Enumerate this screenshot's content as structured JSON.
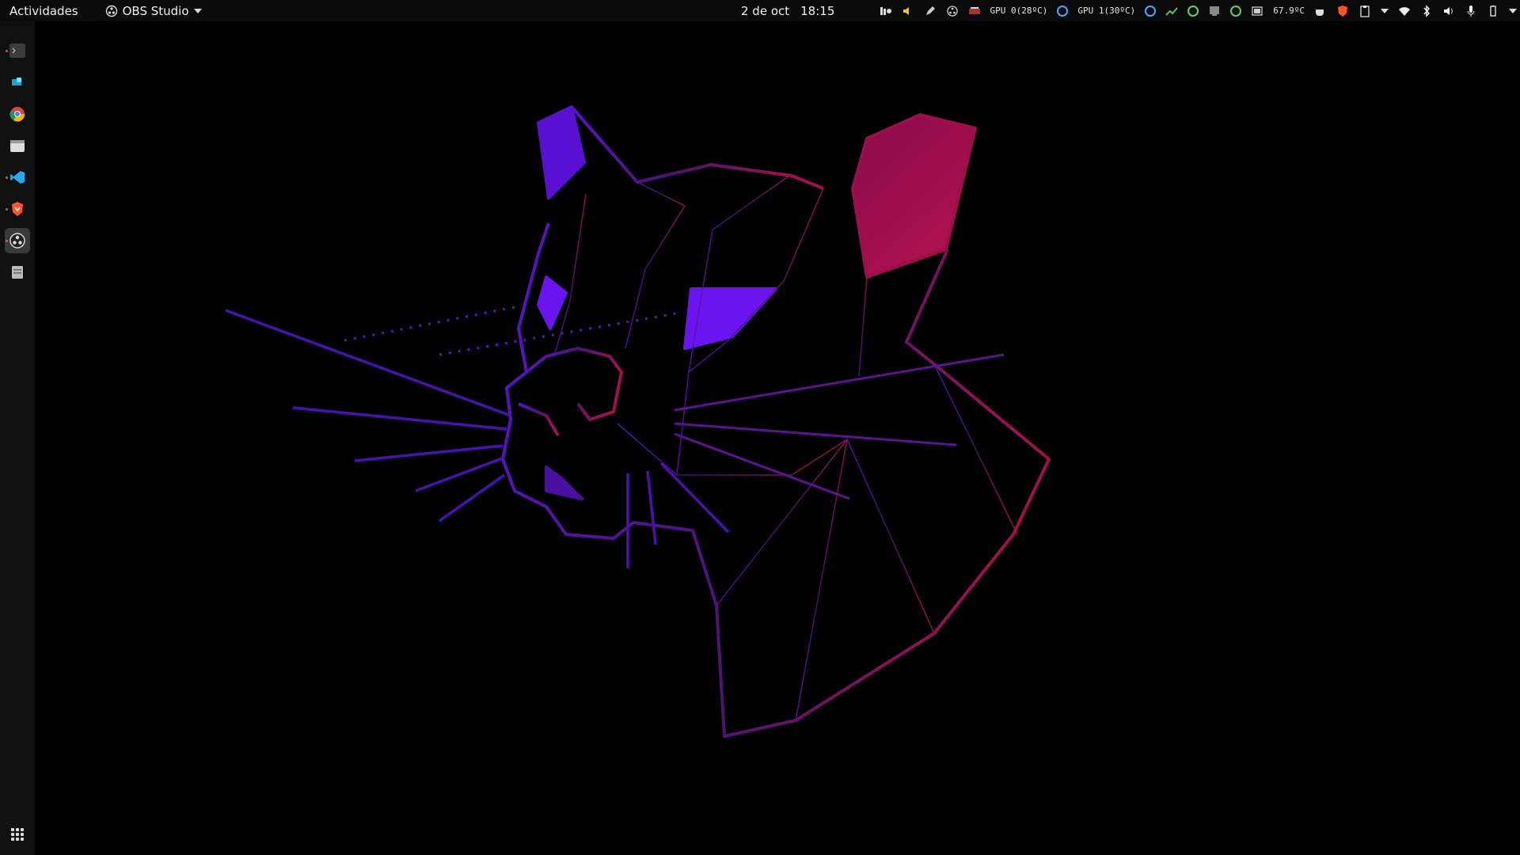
{
  "topbar": {
    "activities": "Actividades",
    "app_menu": "OBS Studio",
    "date": "2 de oct",
    "time": "18:15",
    "gpu0": "GPU 0(28ºC)",
    "gpu1": "GPU 1(30ºC)",
    "cpu_temp": "67.9ºC"
  },
  "dock": {
    "items": [
      "terminal-icon",
      "app-icon",
      "chrome-icon",
      "files-icon",
      "vscode-icon",
      "brave-icon",
      "obs-icon",
      "document-icon"
    ]
  },
  "colors": {
    "purple": "#6a14d8",
    "magenta": "#a0124f",
    "brave": "#fb542b"
  }
}
